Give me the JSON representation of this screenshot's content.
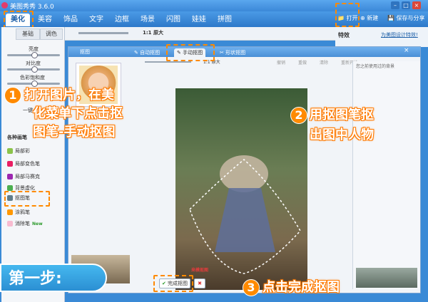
{
  "app": {
    "title": "美图秀秀 3.6.0"
  },
  "menu": {
    "tabs": [
      "美化",
      "美容",
      "饰品",
      "文字",
      "边框",
      "场景",
      "闪图",
      "娃娃",
      "拼图"
    ]
  },
  "topbar": {
    "open": "打开",
    "new": "新建",
    "save": "保存与分享",
    "recommend": "为美图设计特效!",
    "effects": "特效"
  },
  "left": {
    "subtabs": [
      "基础",
      "调色"
    ],
    "sliders": [
      "亮度",
      "对比度",
      "色彩饱和度"
    ],
    "section": "各种画笔",
    "tools": [
      "局部彩",
      "局部变色笔",
      "局部马赛克",
      "背景虚化",
      "抠图笔",
      "涂鸦笔",
      "消除笔"
    ],
    "new_badge": "New",
    "oneclick": "一键"
  },
  "dialog": {
    "title": "抠图",
    "tabs": [
      "自动抠图",
      "手动抠图",
      "形状抠图"
    ],
    "zoom_label": "原大",
    "tools": [
      "撤销",
      "重做",
      "清除",
      "重新开始"
    ],
    "right_title": "您之前使用过的背景",
    "finish": "完成抠图",
    "mini_label": "来模抠图"
  },
  "callouts": {
    "c1": [
      "打开图片，在美",
      "化菜单下点击抠",
      "图笔-手动抠图"
    ],
    "c2": [
      "用抠图笔抠",
      "出图中人物"
    ],
    "c3": "点击完成抠图",
    "step": "第一步:"
  },
  "colors": {
    "accent": "#ff8a00",
    "brand": "#3a8ad6"
  }
}
